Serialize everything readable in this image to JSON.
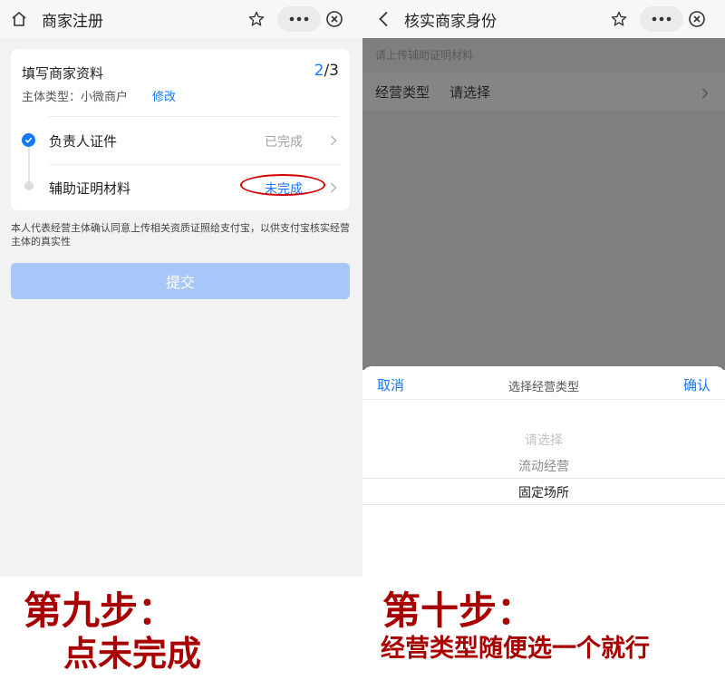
{
  "left": {
    "nav": {
      "title": "商家注册"
    },
    "card": {
      "title": "填写商家资料",
      "step_current": "2",
      "step_total": "/3",
      "subject_label": "主体类型：小微商户",
      "edit_link": "修改",
      "rows": [
        {
          "label": "负责人证件",
          "status": "已完成"
        },
        {
          "label": "辅助证明材料",
          "status": "未完成"
        }
      ]
    },
    "notice": "本人代表经营主体确认同意上传相关资质证照给支付宝，以供支付宝核实经营主体的真实性",
    "submit_label": "提交"
  },
  "right": {
    "nav": {
      "title": "核实商家身份"
    },
    "upload_hint": "请上传辅助证明材料",
    "field": {
      "label": "经营类型",
      "value": "请选择"
    },
    "picker": {
      "cancel": "取消",
      "title": "选择经营类型",
      "confirm": "确认",
      "options": [
        "请选择",
        "流动经营",
        "固定场所"
      ]
    }
  },
  "captions": {
    "step9_title": "第九步：",
    "step9_text": "点未完成",
    "step10_title": "第十步：",
    "step10_text": "经营类型随便选一个就行"
  },
  "colors": {
    "accent": "#1677ff",
    "caption": "#a80000",
    "highlight_ring": "#d40000"
  }
}
